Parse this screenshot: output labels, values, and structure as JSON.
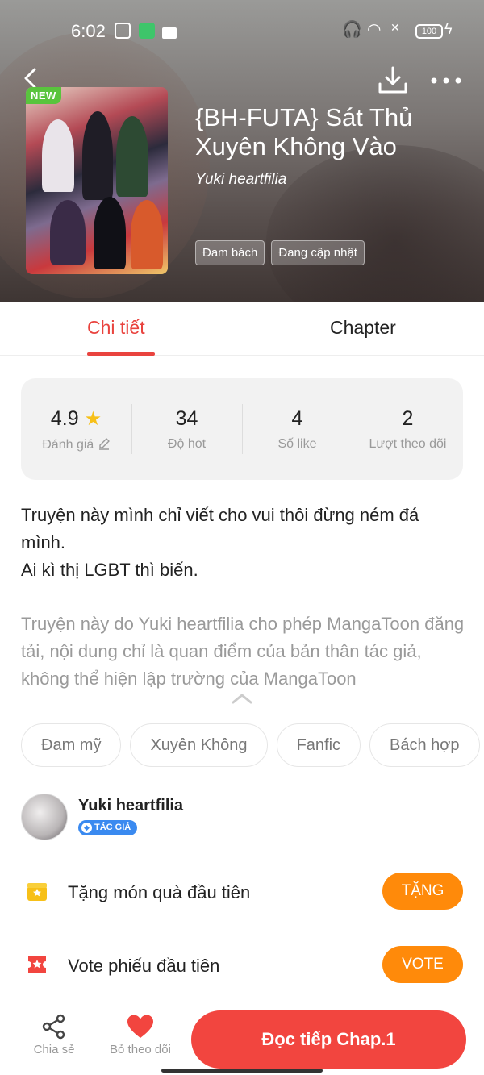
{
  "status_bar": {
    "time": "6:02",
    "battery": "100"
  },
  "manga": {
    "badge": "NEW",
    "title": "{BH-FUTA} Sát Thủ Xuyên Không Vào",
    "author": "Yuki heartfilia",
    "tags": [
      "Đam bách",
      "Đang cập nhật"
    ]
  },
  "tabs": {
    "detail": "Chi tiết",
    "chapter": "Chapter"
  },
  "stats": [
    {
      "value": "4.9",
      "label": "Đánh giá"
    },
    {
      "value": "34",
      "label": "Độ hot"
    },
    {
      "value": "4",
      "label": "Số like"
    },
    {
      "value": "2",
      "label": "Lượt theo dõi"
    }
  ],
  "description": {
    "line1": "Truyện này mình chỉ viết cho vui thôi đừng ném đá mình.",
    "line2": "Ai kì thị LGBT thì biến.",
    "disclaimer": "Truyện này do Yuki heartfilia cho phép MangaToon đăng tải, nội dung chỉ là quan điểm của bản thân tác giả, không thể hiện lập trường của MangaToon"
  },
  "genres": [
    "Đam mỹ",
    "Xuyên Không",
    "Fanfic",
    "Bách hợp"
  ],
  "author_block": {
    "name": "Yuki heartfilia",
    "badge": "TÁC GIẢ"
  },
  "actions": [
    {
      "label": "Tặng món quà đầu tiên",
      "button": "TẶNG"
    },
    {
      "label": "Vote phiếu đầu tiên",
      "button": "VOTE"
    }
  ],
  "bottom_bar": {
    "share": "Chia sẻ",
    "follow": "Bỏ theo dõi",
    "read": "Đọc tiếp Chap.1"
  },
  "colors": {
    "accent": "#e9433e",
    "orange": "#ff8a0a",
    "read_button": "#f2453f",
    "star": "#f7c018",
    "badge_blue": "#3a8af0",
    "new_green": "#59c43d"
  }
}
